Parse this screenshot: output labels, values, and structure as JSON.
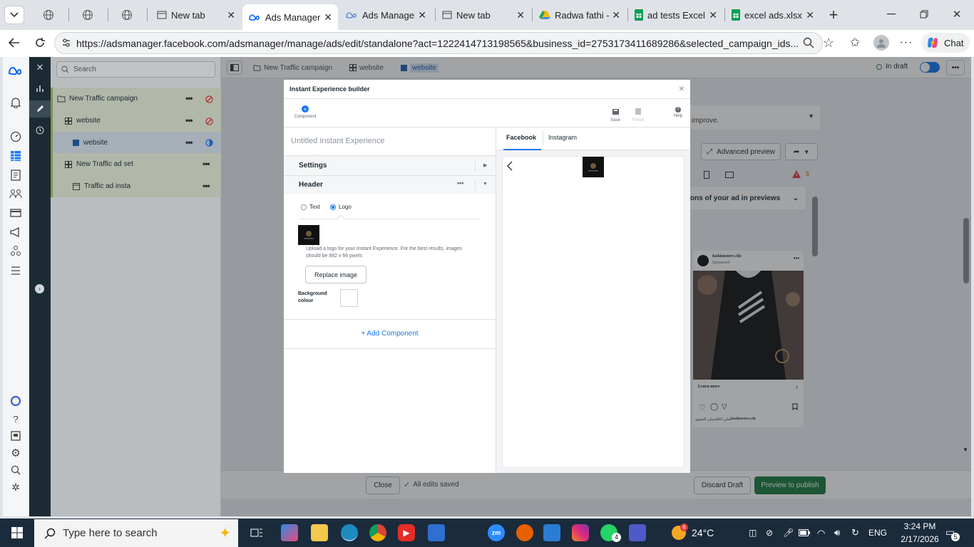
{
  "browser": {
    "tabs": [
      {
        "title": "",
        "icon": "globe-icon"
      },
      {
        "title": "",
        "icon": "globe-icon"
      },
      {
        "title": "",
        "icon": "globe-icon"
      },
      {
        "title": "New tab",
        "icon": "page-icon"
      },
      {
        "title": "Ads Manager -",
        "icon": "meta-icon",
        "active": true
      },
      {
        "title": "Ads Manager -",
        "icon": "meta-icon"
      },
      {
        "title": "New tab",
        "icon": "page-icon"
      },
      {
        "title": "Radwa fathi - (",
        "icon": "drive-icon"
      },
      {
        "title": "ad tests Excel s",
        "icon": "sheets-icon"
      },
      {
        "title": "excel ads.xlsx -",
        "icon": "sheets-icon"
      }
    ],
    "url": "https://adsmanager.facebook.com/adsmanager/manage/ads/edit/standalone?act=1222414713198565&business_id=2753173411689286&selected_campaign_ids...",
    "chat_label": "Chat"
  },
  "topbar": {
    "search_placeholder": "Search",
    "breadcrumb": [
      "New Traffic campaign",
      "website",
      "website"
    ],
    "status": "In draft"
  },
  "tree": [
    {
      "label": "New Traffic campaign",
      "level": 0
    },
    {
      "label": "website",
      "level": 1
    },
    {
      "label": "website",
      "level": 2,
      "selected": true
    },
    {
      "label": "New Traffic ad set",
      "level": 0
    },
    {
      "label": "Traffic ad insta",
      "level": 1
    }
  ],
  "background_panel": {
    "improve_text": "improve.",
    "advanced_preview": "Advanced preview",
    "warning_count": "5",
    "previews_text": "ons of your ad in previews",
    "ad_page_name": "fashionsterc.clic",
    "ad_sponsored": "Sponsored",
    "ad_cta": "Learn more",
    "ad_caption_handle": "fashionsterc.clic",
    "ad_caption_text": "الحلي الكلاسيكي الشتوي"
  },
  "modal": {
    "title": "Instant Experience builder",
    "tools": {
      "component": "Component",
      "save": "Save",
      "finish": "Finish",
      "help": "Help"
    },
    "experience_name_placeholder": "Untitled Instant Experience",
    "settings_label": "Settings",
    "header_label": "Header",
    "radio_text": "Text",
    "radio_logo": "Logo",
    "upload_hint": "Upload a logo for your Instant Experience. For the best results, images should be 882 x 66 pixels",
    "replace_image": "Replace image",
    "background_colour": "Background colour",
    "add_component": "+ Add Component",
    "preview_tabs": [
      "Facebook",
      "Instagram"
    ]
  },
  "footer": {
    "close": "Close",
    "saved": "All edits saved",
    "discard": "Discard Draft",
    "publish": "Preview to publish"
  },
  "taskbar": {
    "search_placeholder": "Type here to search",
    "weather": "24°C",
    "lang": "ENG",
    "time": "3:24 PM",
    "date": "2/17/2026",
    "whatsapp_badge": "4",
    "notif_count": "5",
    "weather_badge": "6"
  },
  "colors": {
    "accent": "#1877f2",
    "publish": "#1b7a3e",
    "warning": "#e2393a"
  }
}
